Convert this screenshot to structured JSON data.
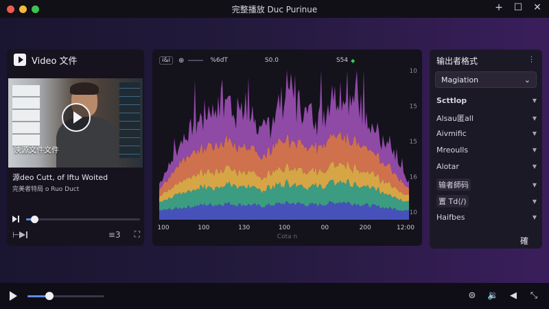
{
  "window": {
    "title": "完整播放 Duc Purinue",
    "controls": {
      "new_tab": "+",
      "maximize": "☐",
      "close": "✕"
    }
  },
  "video_panel": {
    "title": "Video 文件",
    "thumbnail_caption": "浃源文件文件",
    "video_name": "源deo Cutt, of Iftu Woited",
    "video_subtitle": "完美者特局 o Ruo Duct",
    "seek_progress": 0.07,
    "time_label": "≡3"
  },
  "chart_panel": {
    "toolbar": {
      "chip": "ⅰ&ⅰ",
      "label_1": "%6dT",
      "label_2": "S0.0",
      "label_3": "S54"
    },
    "x_caption": "Cota n"
  },
  "settings_panel": {
    "title": "输出者格式",
    "dropdown_value": "Magiation",
    "items": [
      "Scttlop",
      "Alsau匿all",
      "Aivmific",
      "Mreoulls",
      "Alotar",
      "输者師码",
      "置 Td⟨/)",
      "Haifbes"
    ],
    "footer_label": "確"
  },
  "bottom_bar": {
    "progress": 0.29
  },
  "chart_data": {
    "type": "area",
    "title": "",
    "xlabel": "",
    "ylabel": "",
    "x_tick_labels": [
      "100",
      "100",
      "130",
      "100",
      "00",
      "200",
      "12:00"
    ],
    "y_tick_labels": [
      "10",
      "15",
      "15",
      "16",
      "10"
    ],
    "ylim": [
      0,
      1
    ],
    "grid": false,
    "series": [
      {
        "color": "#4b58c8",
        "values": [
          0.06,
          0.07,
          0.08,
          0.09,
          0.1,
          0.1,
          0.11,
          0.1,
          0.1,
          0.09,
          0.1,
          0.11,
          0.11,
          0.1,
          0.1,
          0.11,
          0.12,
          0.11,
          0.1,
          0.09,
          0.08,
          0.07,
          0.06
        ]
      },
      {
        "color": "#3fa88a",
        "values": [
          0.06,
          0.08,
          0.1,
          0.11,
          0.12,
          0.12,
          0.13,
          0.12,
          0.12,
          0.11,
          0.12,
          0.13,
          0.13,
          0.12,
          0.12,
          0.13,
          0.14,
          0.13,
          0.12,
          0.11,
          0.1,
          0.08,
          0.06
        ]
      },
      {
        "color": "#e7b24a",
        "values": [
          0.04,
          0.06,
          0.08,
          0.09,
          0.1,
          0.11,
          0.11,
          0.1,
          0.1,
          0.09,
          0.1,
          0.11,
          0.11,
          0.1,
          0.1,
          0.11,
          0.12,
          0.11,
          0.1,
          0.09,
          0.08,
          0.06,
          0.04
        ]
      },
      {
        "color": "#e17a52",
        "values": [
          0.05,
          0.09,
          0.13,
          0.15,
          0.17,
          0.18,
          0.18,
          0.17,
          0.16,
          0.14,
          0.16,
          0.18,
          0.18,
          0.17,
          0.17,
          0.18,
          0.19,
          0.18,
          0.16,
          0.14,
          0.12,
          0.09,
          0.05
        ]
      },
      {
        "color": "#9a4fb2",
        "values": [
          0.04,
          0.08,
          0.14,
          0.18,
          0.22,
          0.26,
          0.25,
          0.22,
          0.2,
          0.16,
          0.2,
          0.28,
          0.26,
          0.22,
          0.2,
          0.24,
          0.3,
          0.27,
          0.22,
          0.16,
          0.12,
          0.08,
          0.04
        ]
      }
    ]
  }
}
